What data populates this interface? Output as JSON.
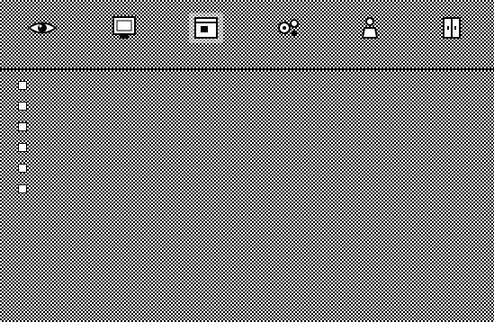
{
  "toolbar": {
    "tabs": [
      {
        "icon": "eye-icon",
        "label": ""
      },
      {
        "icon": "display-icon",
        "label": ""
      },
      {
        "icon": "window-icon",
        "label": ""
      },
      {
        "icon": "gears-icon",
        "label": ""
      },
      {
        "icon": "person-icon",
        "label": ""
      },
      {
        "icon": "cabinet-icon",
        "label": ""
      }
    ]
  },
  "panes": {
    "items": [
      {
        "label": "",
        "value": ""
      },
      {
        "label": "",
        "value": ""
      },
      {
        "label": "",
        "value": ""
      },
      {
        "label": "",
        "value": ""
      },
      {
        "label": ""
      },
      {
        "label": ""
      }
    ]
  }
}
